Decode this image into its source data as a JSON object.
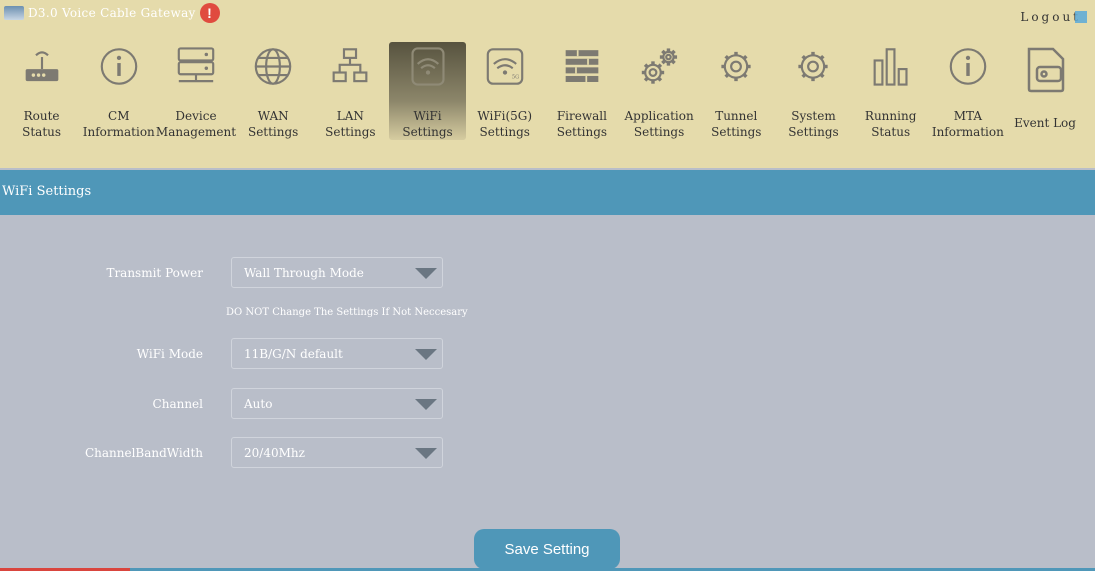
{
  "header": {
    "title": "D3.0 Voice Cable Gateway",
    "logout": "Logout"
  },
  "nav": [
    {
      "l1": "Route",
      "l2": "Status",
      "icon": "router-icon"
    },
    {
      "l1": "CM",
      "l2": "Information",
      "icon": "info-icon"
    },
    {
      "l1": "Device",
      "l2": "Management",
      "icon": "server-icon"
    },
    {
      "l1": "WAN",
      "l2": "Settings",
      "icon": "globe-icon"
    },
    {
      "l1": "LAN",
      "l2": "Settings",
      "icon": "network-icon"
    },
    {
      "l1": "WiFi",
      "l2": "Settings",
      "icon": "wifi-icon",
      "active": true
    },
    {
      "l1": "WiFi(5G)",
      "l2": "Settings",
      "icon": "wifi-5g-icon"
    },
    {
      "l1": "Firewall",
      "l2": "Settings",
      "icon": "firewall-icon"
    },
    {
      "l1": "Application",
      "l2": "Settings",
      "icon": "gears-icon"
    },
    {
      "l1": "Tunnel",
      "l2": "Settings",
      "icon": "gear-icon"
    },
    {
      "l1": "System",
      "l2": "Settings",
      "icon": "gear-icon"
    },
    {
      "l1": "Running",
      "l2": "Status",
      "icon": "bar-chart-icon"
    },
    {
      "l1": "MTA",
      "l2": "Information",
      "icon": "info-icon"
    },
    {
      "l1": "Event Log",
      "l2": "",
      "icon": "log-icon"
    }
  ],
  "section": {
    "title": "WiFi Settings"
  },
  "form": {
    "transmit_power": {
      "label": "Transmit Power",
      "value": "Wall Through Mode"
    },
    "note": "DO NOT Change The Settings If Not Neccesary",
    "wifi_mode": {
      "label": "WiFi Mode",
      "value": "11B/G/N default"
    },
    "channel": {
      "label": "Channel",
      "value": "Auto"
    },
    "bandwidth": {
      "label": "ChannelBandWidth",
      "value": "20/40Mhz"
    }
  },
  "save_label": "Save Setting"
}
